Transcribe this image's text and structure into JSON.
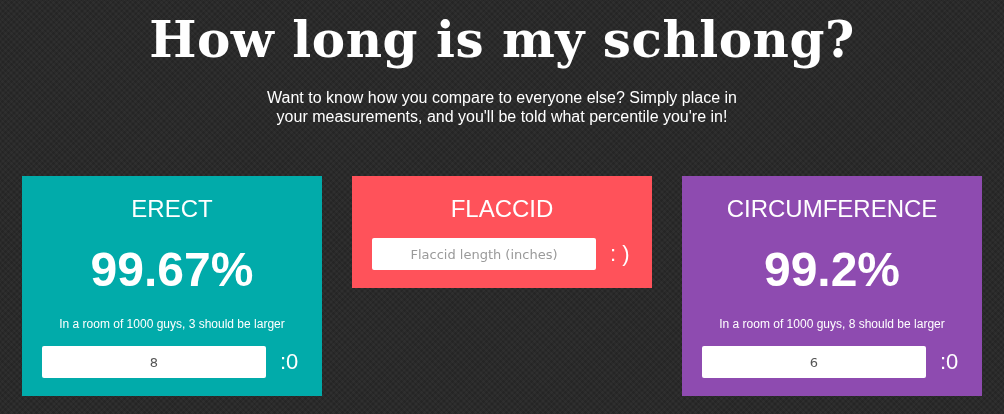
{
  "title": "How long is my schlong?",
  "intro": "Want to know how you compare to everyone else? Simply place in your measurements, and you'll be told what percentile you're in!",
  "cards": [
    {
      "heading": "ERECT",
      "color": "#01abaa",
      "percentile": "99.67%",
      "sentence": "In a room of 1000 guys, 3 should be larger",
      "value": "8",
      "emoticon": ":0"
    },
    {
      "heading": "FLACCID",
      "color": "#ff525a",
      "placeholder": "Flaccid length (inches)",
      "emoticon": ": )"
    },
    {
      "heading": "CIRCUMFERENCE",
      "color": "#8e4bb0",
      "percentile": "99.2%",
      "sentence": "In a room of 1000 guys, 8 should be larger",
      "value": "6",
      "emoticon": ":0"
    }
  ]
}
